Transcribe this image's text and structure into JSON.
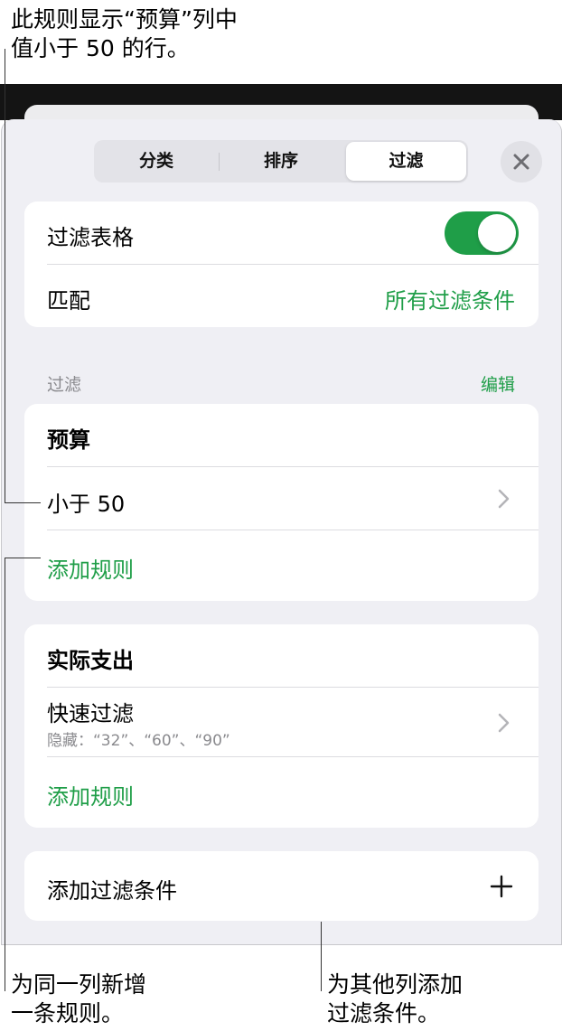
{
  "callouts": {
    "top": [
      "此规则显示“预算”列中",
      "值小于 50 的行。"
    ],
    "bottom_left": [
      "为同一列新增",
      "一条规则。"
    ],
    "bottom_right": [
      "为其他列添加",
      "过滤条件。"
    ]
  },
  "segmented": {
    "items": [
      "分类",
      "排序",
      "过滤"
    ],
    "selected": "过滤"
  },
  "close_icon": "close-icon",
  "filter_table": {
    "label": "过滤表格",
    "toggle_on": true,
    "match_label": "匹配",
    "match_value": "所有过滤条件"
  },
  "filters_section": {
    "header": "过滤",
    "edit": "编辑"
  },
  "group_budget": {
    "title": "预算",
    "rule": "小于 50",
    "add_rule": "添加规则"
  },
  "group_actual": {
    "title": "实际支出",
    "rule": "快速过滤",
    "rule_sub": "隐藏：“32”、“60”、“90”",
    "add_rule": "添加规则"
  },
  "add_filter": {
    "label": "添加过滤条件",
    "icon": "plus-icon"
  },
  "colors": {
    "accent": "#1f9e48",
    "background": "#efeff4"
  }
}
